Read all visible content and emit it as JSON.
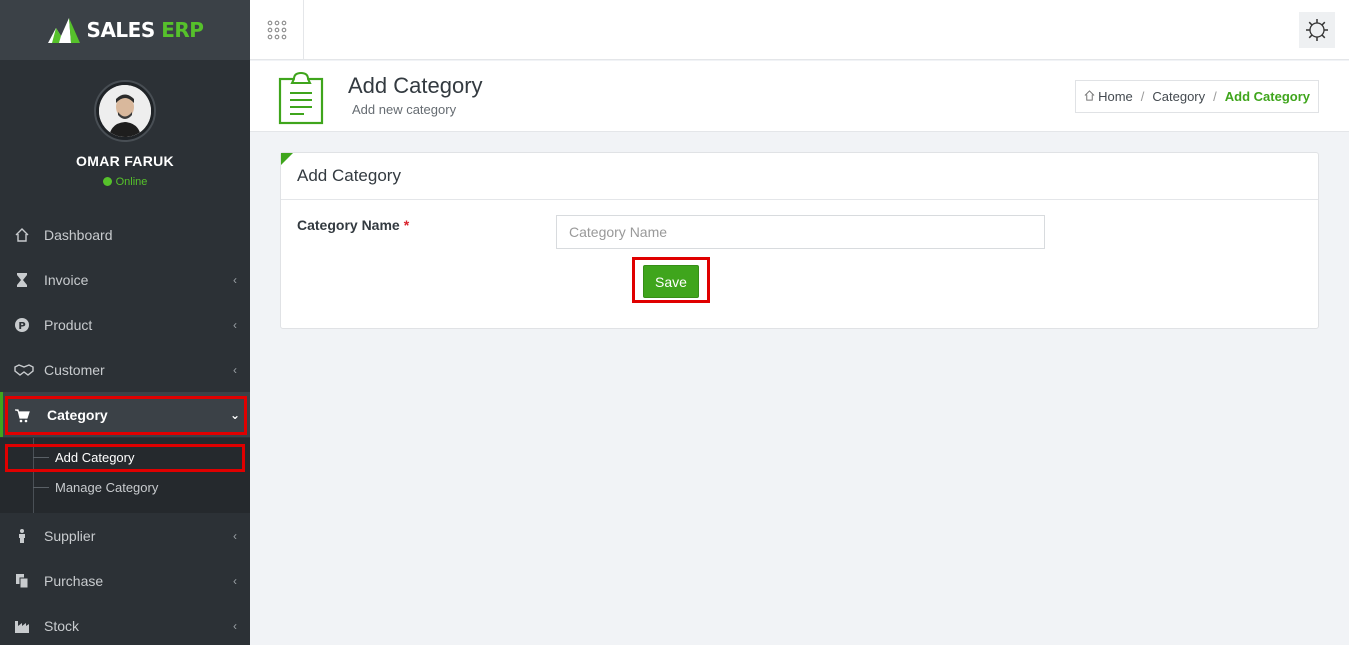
{
  "brand": {
    "name_main": "SALES",
    "name_accent": "ERP"
  },
  "user": {
    "name": "OMAR FARUK",
    "status": "Online"
  },
  "sidebar": {
    "items": [
      {
        "label": "Dashboard",
        "icon": "home-icon"
      },
      {
        "label": "Invoice",
        "icon": "hourglass-icon"
      },
      {
        "label": "Product",
        "icon": "product-p-icon"
      },
      {
        "label": "Customer",
        "icon": "handshake-icon"
      },
      {
        "label": "Category",
        "icon": "cart-icon"
      },
      {
        "label": "Supplier",
        "icon": "person-icon"
      },
      {
        "label": "Purchase",
        "icon": "copy-icon"
      },
      {
        "label": "Stock",
        "icon": "factory-icon"
      }
    ],
    "category_sub": [
      {
        "label": "Add Category"
      },
      {
        "label": "Manage Category"
      }
    ]
  },
  "page": {
    "title": "Add Category",
    "subtitle": "Add new category"
  },
  "breadcrumb": {
    "home": "Home",
    "parent": "Category",
    "current": "Add Category",
    "sep": "/"
  },
  "card": {
    "title": "Add Category",
    "field_label": "Category Name",
    "required_mark": "*",
    "field_placeholder": "Category Name",
    "field_value": "",
    "save_label": "Save"
  },
  "colors": {
    "accent": "#3fa51c",
    "sidebar_bg": "#2c3136",
    "highlight": "#e00000"
  }
}
